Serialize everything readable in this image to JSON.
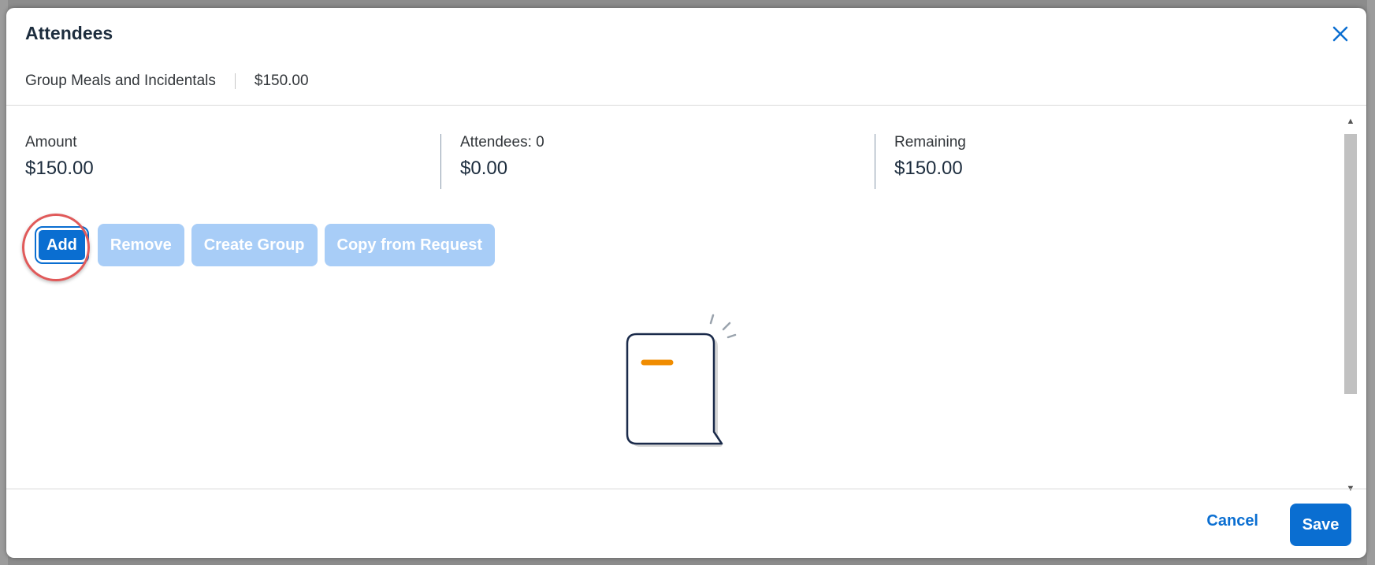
{
  "dialog": {
    "title": "Attendees",
    "expense_type": "Group Meals and Incidentals",
    "expense_amount": "$150.00"
  },
  "summary": {
    "amount_label": "Amount",
    "amount_value": "$150.00",
    "attendees_label": "Attendees: 0",
    "attendees_value": "$0.00",
    "remaining_label": "Remaining",
    "remaining_value": "$150.00"
  },
  "toolbar": {
    "add_label": "Add",
    "remove_label": "Remove",
    "create_group_label": "Create Group",
    "copy_from_request_label": "Copy from Request"
  },
  "footer": {
    "cancel_label": "Cancel",
    "save_label": "Save"
  },
  "icons": {
    "close": "close-icon",
    "empty_state": "empty-document-illustration",
    "scroll_up": "scroll-up-icon",
    "scroll_down": "scroll-down-icon"
  },
  "colors": {
    "accent": "#0a6ed1",
    "disabled_button": "#a8cdf7",
    "highlight_ring": "#e05a5a",
    "illustration_stroke": "#1a2a4a",
    "illustration_accent": "#f08c00"
  }
}
